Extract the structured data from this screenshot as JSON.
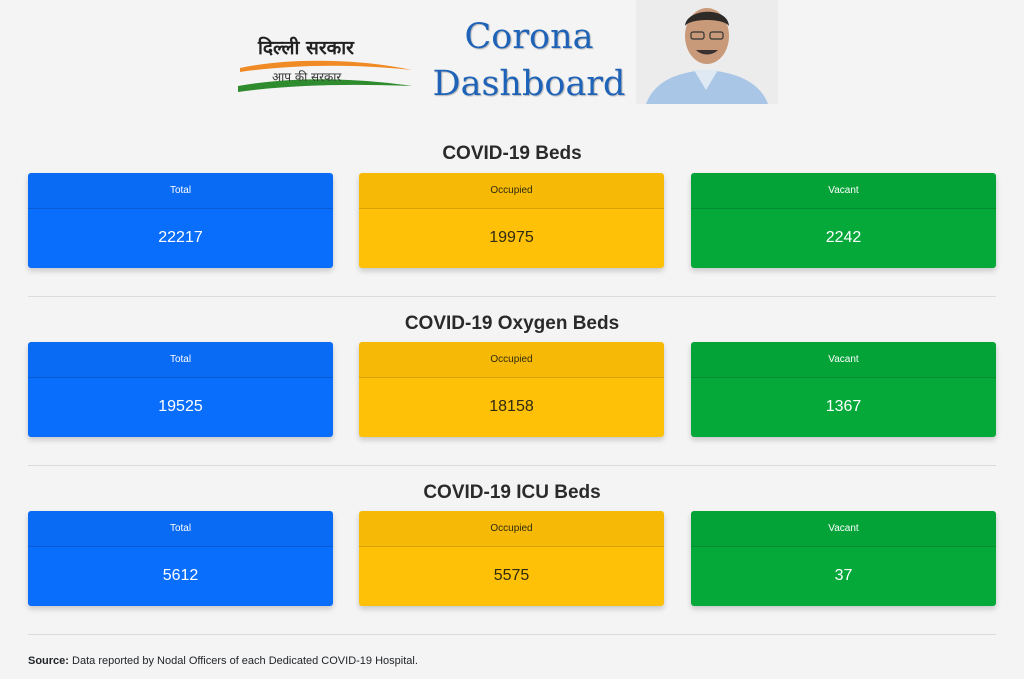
{
  "header": {
    "logo_line1": "दिल्ली सरकार",
    "logo_line2": "आप की सरकार",
    "title_line1": "Corona",
    "title_line2": "Dashboard"
  },
  "sections": [
    {
      "title": "COVID-19 Beds",
      "total_label": "Total",
      "total_value": "22217",
      "occupied_label": "Occupied",
      "occupied_value": "19975",
      "vacant_label": "Vacant",
      "vacant_value": "2242"
    },
    {
      "title": "COVID-19 Oxygen Beds",
      "total_label": "Total",
      "total_value": "19525",
      "occupied_label": "Occupied",
      "occupied_value": "18158",
      "vacant_label": "Vacant",
      "vacant_value": "1367"
    },
    {
      "title": "COVID-19 ICU Beds",
      "total_label": "Total",
      "total_value": "5612",
      "occupied_label": "Occupied",
      "occupied_value": "5575",
      "vacant_label": "Vacant",
      "vacant_value": "37"
    }
  ],
  "footer": {
    "source_label": "Source:",
    "source_text": "Data reported by Nodal Officers of each Dedicated COVID-19 Hospital."
  },
  "colors": {
    "total": "#0a6efc",
    "occupied": "#fec107",
    "vacant": "#05a93a",
    "title": "#1f63b8"
  }
}
